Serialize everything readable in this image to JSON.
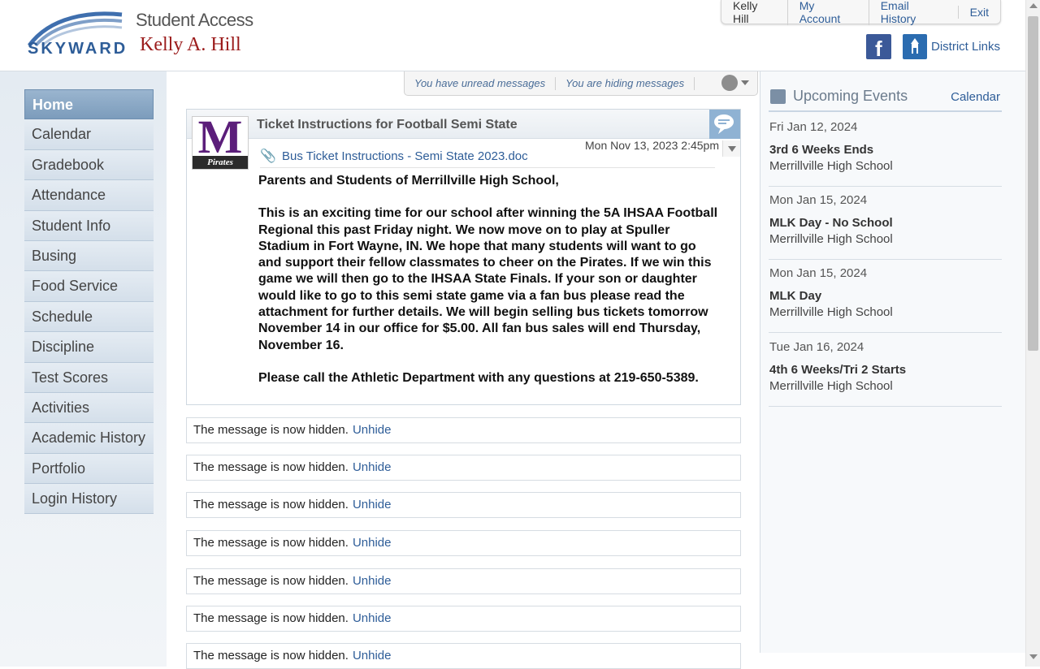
{
  "header": {
    "logo_text": "SKYWARD",
    "app_title": "Student Access",
    "student_name": "Kelly A. Hill"
  },
  "topnav": {
    "user": "Kelly Hill",
    "my_account": "My Account",
    "email_history": "Email History",
    "exit": "Exit"
  },
  "links": {
    "facebook_icon": "facebook-icon",
    "district_links": "District Links"
  },
  "sidebar": {
    "items": [
      {
        "label": "Home",
        "active": true
      },
      {
        "label": "Calendar"
      },
      {
        "label": "Gradebook"
      },
      {
        "label": "Attendance"
      },
      {
        "label": "Student Info"
      },
      {
        "label": "Busing"
      },
      {
        "label": "Food Service"
      },
      {
        "label": "Schedule"
      },
      {
        "label": "Discipline"
      },
      {
        "label": "Test Scores"
      },
      {
        "label": "Activities"
      },
      {
        "label": "Academic History"
      },
      {
        "label": "Portfolio"
      },
      {
        "label": "Login History"
      }
    ]
  },
  "toolbar": {
    "unread": "You have unread messages",
    "hiding": "You are hiding messages"
  },
  "message": {
    "title": "Ticket Instructions for Football Semi State",
    "logo_letter": "M",
    "logo_text": "Pirates",
    "attachment": "Bus Ticket Instructions - Semi State 2023.doc",
    "date": "Mon Nov 13, 2023 2:45pm",
    "greeting": "Parents and Students of Merrillville High School,",
    "paragraph": "This is an exciting time for our school after winning the 5A IHSAA Football Regional this past Friday night.  We now move on to play at Spuller Stadium in Fort Wayne, IN.   We hope that many students will want to go and support their fellow classmates to cheer on the Pirates.  If we win this game we will then go to the IHSAA State Finals.   If your son or daughter would like to go to this semi state game via a fan bus please read the attachment for further details.  We will begin selling bus tickets tomorrow November 14 in our office for $5.00.  All fan bus sales will end Thursday, November 16.",
    "closing": "Please call the Athletic Department with any questions at 219-650-5389."
  },
  "hidden_messages": [
    {
      "text": "The message is now hidden.",
      "link": "Unhide"
    },
    {
      "text": "The message is now hidden.",
      "link": "Unhide"
    },
    {
      "text": "The message is now hidden.",
      "link": "Unhide"
    },
    {
      "text": "The message is now hidden.",
      "link": "Unhide"
    },
    {
      "text": "The message is now hidden.",
      "link": "Unhide"
    },
    {
      "text": "The message is now hidden.",
      "link": "Unhide"
    },
    {
      "text": "The message is now hidden.",
      "link": "Unhide"
    }
  ],
  "events": {
    "title": "Upcoming Events",
    "calendar_link": "Calendar",
    "items": [
      {
        "date": "Fri Jan 12, 2024",
        "name": "3rd 6 Weeks Ends",
        "school": "Merrillville High School"
      },
      {
        "date": "Mon Jan 15, 2024",
        "name": "MLK Day - No School",
        "school": "Merrillville High School"
      },
      {
        "date": "Mon Jan 15, 2024",
        "name": "MLK Day",
        "school": "Merrillville High School"
      },
      {
        "date": "Tue Jan 16, 2024",
        "name": "4th 6 Weeks/Tri 2 Starts",
        "school": "Merrillville High School"
      }
    ]
  },
  "colors": {
    "link": "#2e5d98",
    "student_name": "#9b1b1b",
    "active_nav": "#8aa9c8"
  }
}
